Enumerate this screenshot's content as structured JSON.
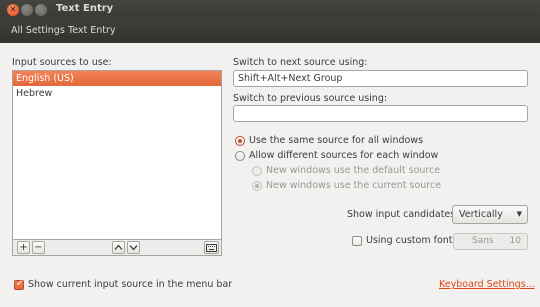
{
  "window": {
    "title": "Text Entry"
  },
  "nav": {
    "all_settings": "All Settings",
    "current": "Text Entry"
  },
  "input_sources": {
    "label": "Input sources to use:",
    "items": [
      "English (US)",
      "Hebrew"
    ],
    "selected_index": 0
  },
  "shortcuts": {
    "next_label": "Switch to next source using:",
    "next_value": "Shift+Alt+Next Group",
    "prev_label": "Switch to previous source using:",
    "prev_value": ""
  },
  "source_mode": {
    "same_label": "Use the same source for all windows",
    "different_label": "Allow different sources for each window",
    "new_default_label": "New windows use the default source",
    "new_current_label": "New windows use the current source",
    "selected": "same"
  },
  "candidates": {
    "label": "Show input candidates:",
    "value": "Vertically"
  },
  "custom_font": {
    "label": "Using custom font:",
    "checked": false,
    "font_name": "Sans",
    "font_size": "10"
  },
  "footer": {
    "show_indicator_label": "Show current input source in the menu bar",
    "show_indicator_checked": true,
    "keyboard_settings_link": "Keyboard Settings..."
  },
  "colors": {
    "accent": "#dd4814",
    "selection": "#f07746"
  }
}
